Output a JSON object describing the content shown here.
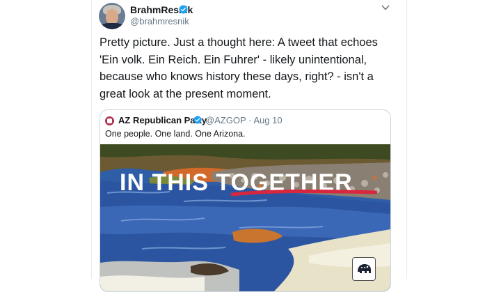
{
  "tweet": {
    "author_name": "BrahmResnik",
    "author_handle": "@brahmresnik",
    "text": "Pretty picture. Just a thought here: A tweet that echoes 'Ein volk. Ein Reich. Ein Fuhrer' - likely unintentional, because who knows history these days, right? - isn't a great look at the present moment.",
    "verified_icon": "verified-badge-icon",
    "menu_icon": "chevron-down-icon"
  },
  "quoted_tweet": {
    "author_name": "AZ Republican Party",
    "author_handle": "@AZGOP",
    "separator": "·",
    "date": "Aug 10",
    "text": "One people. One land. One Arizona.",
    "image": {
      "overlay_text": "IN THIS TOGETHER",
      "logo": "gop-elephant-logo-icon"
    }
  },
  "colors": {
    "verified_blue": "#1da1f2",
    "secondary_text": "#657786",
    "border": "#ccd6dd",
    "underline_red": "#d7263d"
  }
}
